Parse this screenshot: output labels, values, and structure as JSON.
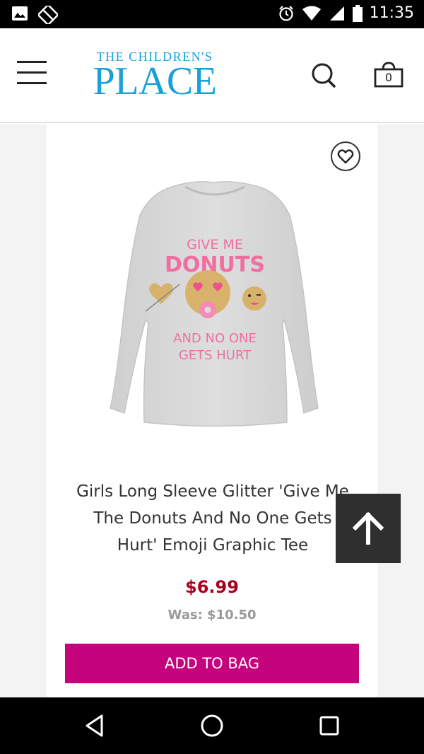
{
  "status_bar": {
    "time": "11:35",
    "icons": [
      "image-icon",
      "no-signal-icon",
      "alarm-icon",
      "wifi-icon",
      "signal-icon",
      "battery-icon"
    ]
  },
  "header": {
    "logo_top": "THE CHILDREN'S",
    "logo_main": "PLACE",
    "bag_count": "0",
    "logo_color": "#1aa0d9"
  },
  "product": {
    "title": "Girls Long Sleeve Glitter 'Give Me The Donuts And No One Gets Hurt' Emoji Graphic Tee",
    "price": "$6.99",
    "was_price": "Was: $10.50",
    "add_to_bag_label": "ADD TO BAG",
    "graphic_text": {
      "line1": "GIVE ME",
      "line2": "DONUTS",
      "line3": "AND NO ONE",
      "line4": "GETS HURT"
    },
    "accent_color": "#c4037d",
    "price_color": "#a8001e"
  },
  "nav_bar": {
    "icons": [
      "back-icon",
      "home-icon",
      "recents-icon"
    ]
  }
}
